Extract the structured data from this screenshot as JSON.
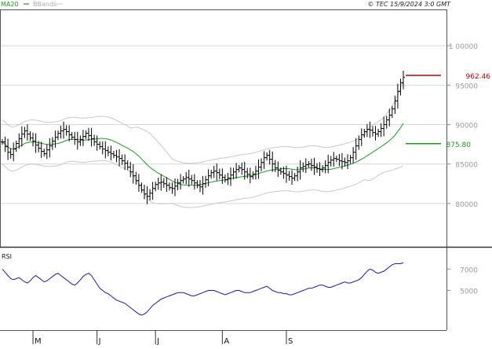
{
  "header": {
    "legend_ma20": "MA20",
    "legend_bbands": "BBands",
    "copyright": "© TEC 15/9/2024 3:0 GMT"
  },
  "colors": {
    "price": "#000000",
    "ma20": "#1a9a1a",
    "bbands": "#c8c8c8",
    "rsi": "#1a1ab4",
    "last_price": "#c00000",
    "grid": "#d8d8d8"
  },
  "chart_data": [
    {
      "type": "ohlc",
      "yaxis_ticks": [
        "1 00000",
        "95000",
        "90000",
        "85000",
        "80000"
      ],
      "ylim": [
        74500,
        104500
      ],
      "x_months": [
        "M",
        "J",
        "J",
        "A",
        "S"
      ],
      "last_price": {
        "value": 96246,
        "label": "962.46"
      },
      "ma_last": {
        "value": 87580,
        "label": "875.80"
      },
      "close": [
        87800,
        87200,
        86500,
        86200,
        86900,
        87600,
        88200,
        88800,
        89200,
        88800,
        88300,
        87900,
        87400,
        87000,
        86600,
        86300,
        86800,
        87300,
        87900,
        88400,
        88900,
        89200,
        89400,
        89100,
        88700,
        88400,
        88100,
        87800,
        88100,
        88500,
        88900,
        88600,
        88200,
        87800,
        87500,
        87200,
        86900,
        86700,
        86500,
        86300,
        86100,
        85900,
        85700,
        85400,
        85100,
        84600,
        84000,
        83500,
        82900,
        82300,
        81700,
        81200,
        80900,
        81300,
        81900,
        82400,
        82600,
        82700,
        82500,
        82300,
        82000,
        81900,
        82200,
        82600,
        82900,
        83100,
        83300,
        83100,
        82900,
        82600,
        82300,
        82100,
        82500,
        83000,
        83500,
        83900,
        84100,
        83900,
        83600,
        83300,
        83000,
        83200,
        83600,
        84000,
        84300,
        84500,
        84300,
        84000,
        83700,
        83400,
        83700,
        84100,
        84600,
        85200,
        85800,
        86100,
        85600,
        85000,
        84500,
        84200,
        84000,
        83800,
        83600,
        83400,
        83200,
        83500,
        84000,
        84500,
        84700,
        84900,
        85000,
        84800,
        84600,
        84400,
        84300,
        84500,
        84800,
        85200,
        85500,
        85700,
        85600,
        85400,
        85300,
        85200,
        85400,
        85800,
        86500,
        87300,
        88100,
        88700,
        89100,
        89400,
        89300,
        89000,
        88800,
        89100,
        89500,
        90000,
        90600,
        91200,
        92000,
        93000,
        94200,
        95300,
        96000
      ]
    },
    {
      "type": "line",
      "title": "RSI",
      "yaxis_ticks": [
        "7000",
        "5000"
      ],
      "ylim": [
        13,
        90
      ],
      "values": [
        70,
        67,
        64,
        61,
        60,
        61,
        62,
        60,
        58,
        57,
        59,
        62,
        64,
        62,
        60,
        58,
        59,
        61,
        63,
        65,
        66,
        64,
        62,
        60,
        58,
        56,
        55,
        57,
        60,
        63,
        65,
        66,
        64,
        60,
        56,
        52,
        50,
        48,
        47,
        45,
        43,
        41,
        40,
        39,
        38,
        36,
        34,
        32,
        30,
        28,
        27,
        28,
        30,
        33,
        36,
        38,
        40,
        42,
        43,
        44,
        45,
        46,
        47,
        48,
        48,
        48,
        47,
        46,
        45,
        45,
        46,
        47,
        48,
        49,
        50,
        50,
        50,
        49,
        48,
        47,
        46,
        47,
        48,
        49,
        50,
        50,
        49,
        48,
        48,
        48,
        49,
        50,
        51,
        52,
        53,
        54,
        52,
        50,
        49,
        48,
        48,
        47,
        47,
        46,
        46,
        47,
        48,
        49,
        50,
        51,
        52,
        52,
        53,
        54,
        55,
        55,
        54,
        53,
        53,
        54,
        55,
        56,
        57,
        58,
        57,
        57,
        58,
        59,
        60,
        62,
        65,
        68,
        70,
        69,
        67,
        66,
        67,
        68,
        70,
        72,
        74,
        75,
        75,
        75,
        76
      ]
    }
  ]
}
